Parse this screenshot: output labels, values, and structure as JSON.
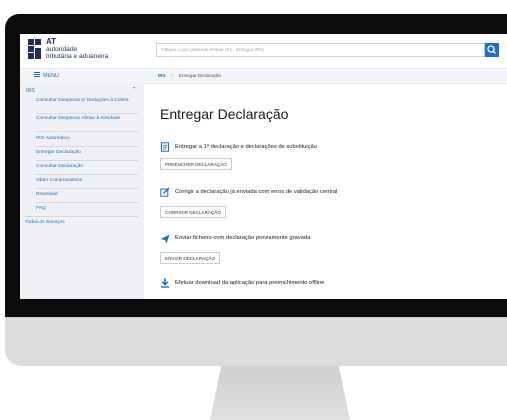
{
  "logo": {
    "line1": "AT",
    "line2": "autoridade",
    "line3": "tributária e aduaneira"
  },
  "header": {
    "search_placeholder": "Indique o que pretende efetuar (Ex.: Entregar IRS)",
    "search_icon": "search-icon"
  },
  "topbar": {
    "menu_label": "MENU",
    "breadcrumb_root": "IRS",
    "breadcrumb_sep": ">",
    "breadcrumb_current": "Entregar Declaração"
  },
  "sidebar": {
    "section": "IRS",
    "items": [
      "Consultar Despesas p/ Deduções à Coleta",
      "Consultar Despesas Afetas à Atividade",
      "IRS Automático",
      "Entregar Declaração",
      "Consultar Declaração",
      "Obter Comprovativos",
      "Download",
      "FAQ"
    ],
    "all_services": "Todos os Serviços"
  },
  "main": {
    "title": "Entregar Declaração",
    "actions": [
      {
        "text": "Entregar a 1ª declaração e declarações de substituição",
        "button": "PREENCHER DECLARAÇÃO",
        "icon": "document-icon"
      },
      {
        "text": "Corrigir a declaração já enviada com erros de validação central",
        "button": "CORRIGIR DECLARAÇÃO",
        "icon": "edit-icon"
      },
      {
        "text": "Enviar ficheiro com declaração previamente gravada",
        "button": "ENVIAR DECLARAÇÃO",
        "icon": "send-icon"
      },
      {
        "text": "Efetuar download da aplicação para preenchimento offline",
        "button": "",
        "icon": "download-icon"
      }
    ]
  },
  "colors": {
    "brand": "#1f2d5c",
    "link": "#1f6fc4",
    "sidebar_bg": "#eef0f3",
    "bezel": "#0b0b0b",
    "monitor": "#dcdcdc"
  }
}
